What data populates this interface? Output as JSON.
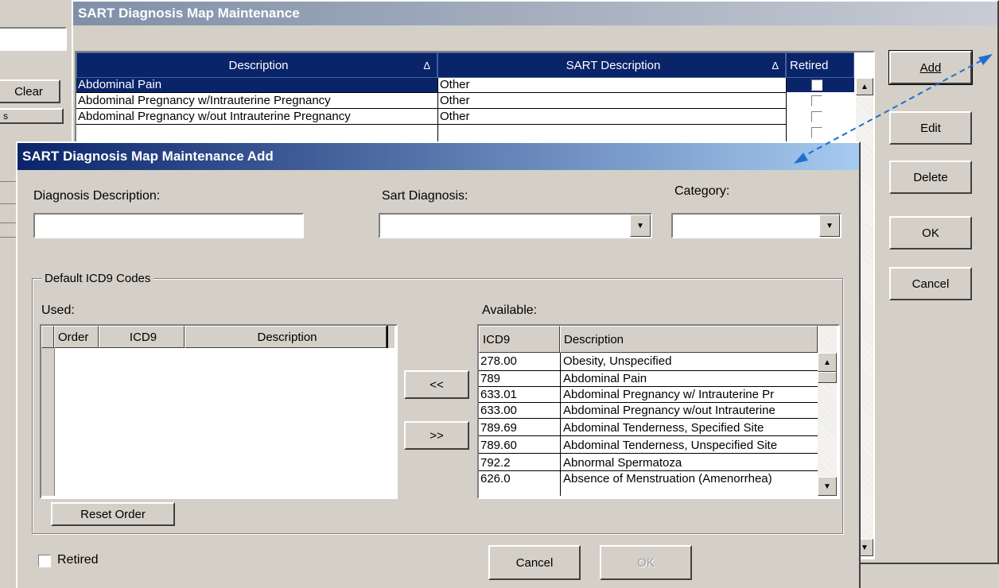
{
  "parent": {
    "title": "SART Diagnosis Map Maintenance",
    "left_buttons": {
      "clear": "Clear",
      "s": "s"
    },
    "columns": {
      "description": "Description",
      "sart_description": "SART Description",
      "retired": "Retired"
    },
    "rows": [
      {
        "description": "Abdominal Pain",
        "sart": "Other",
        "selected": true
      },
      {
        "description": "Abdominal Pregnancy w/Intrauterine Pregnancy",
        "sart": "Other",
        "selected": false
      },
      {
        "description": "Abdominal Pregnancy w/out Intrauterine Pregnancy",
        "sart": "Other",
        "selected": false
      }
    ],
    "buttons": {
      "add": "Add",
      "edit": "Edit",
      "delete": "Delete",
      "ok": "OK",
      "cancel": "Cancel"
    }
  },
  "dialog": {
    "title": "SART Diagnosis Map Maintenance Add",
    "diagnosis_description_label": "Diagnosis Description:",
    "diagnosis_description_value": "",
    "sart_diagnosis_label": "Sart Diagnosis:",
    "sart_diagnosis_value": "",
    "category_label": "Category:",
    "category_value": "",
    "group_label": "Default ICD9 Codes",
    "used_label": "Used:",
    "used_columns": {
      "order": "Order",
      "icd9": "ICD9",
      "description": "Description"
    },
    "available_label": "Available:",
    "available_columns": {
      "icd9": "ICD9",
      "description": "Description"
    },
    "available_rows": [
      {
        "icd9": "278.00",
        "description": " Obesity, Unspecified"
      },
      {
        "icd9": "789",
        "description": "Abdominal Pain"
      },
      {
        "icd9": "633.01",
        "description": "Abdominal Pregnancy w/ Intrauterine Pr"
      },
      {
        "icd9": "633.00",
        "description": "Abdominal Pregnancy w/out Intrauterine"
      },
      {
        "icd9": "789.69",
        "description": "Abdominal Tenderness, Specified Site"
      },
      {
        "icd9": "789.60",
        "description": "Abdominal Tenderness, Unspecified Site"
      },
      {
        "icd9": "792.2",
        "description": "Abnormal Spermatoza"
      },
      {
        "icd9": "626.0",
        "description": "Absence of Menstruation (Amenorrhea)"
      }
    ],
    "move_left_label": "<<",
    "move_right_label": ">>",
    "reset_order_label": "Reset Order",
    "retired_label": "Retired",
    "cancel_label": "Cancel",
    "ok_label": "OK"
  },
  "colors": {
    "title_gradient_start": "#0a246a",
    "title_gradient_end": "#a6caf0",
    "selection": "#0a246a",
    "arrow": "#1f6fd0"
  }
}
